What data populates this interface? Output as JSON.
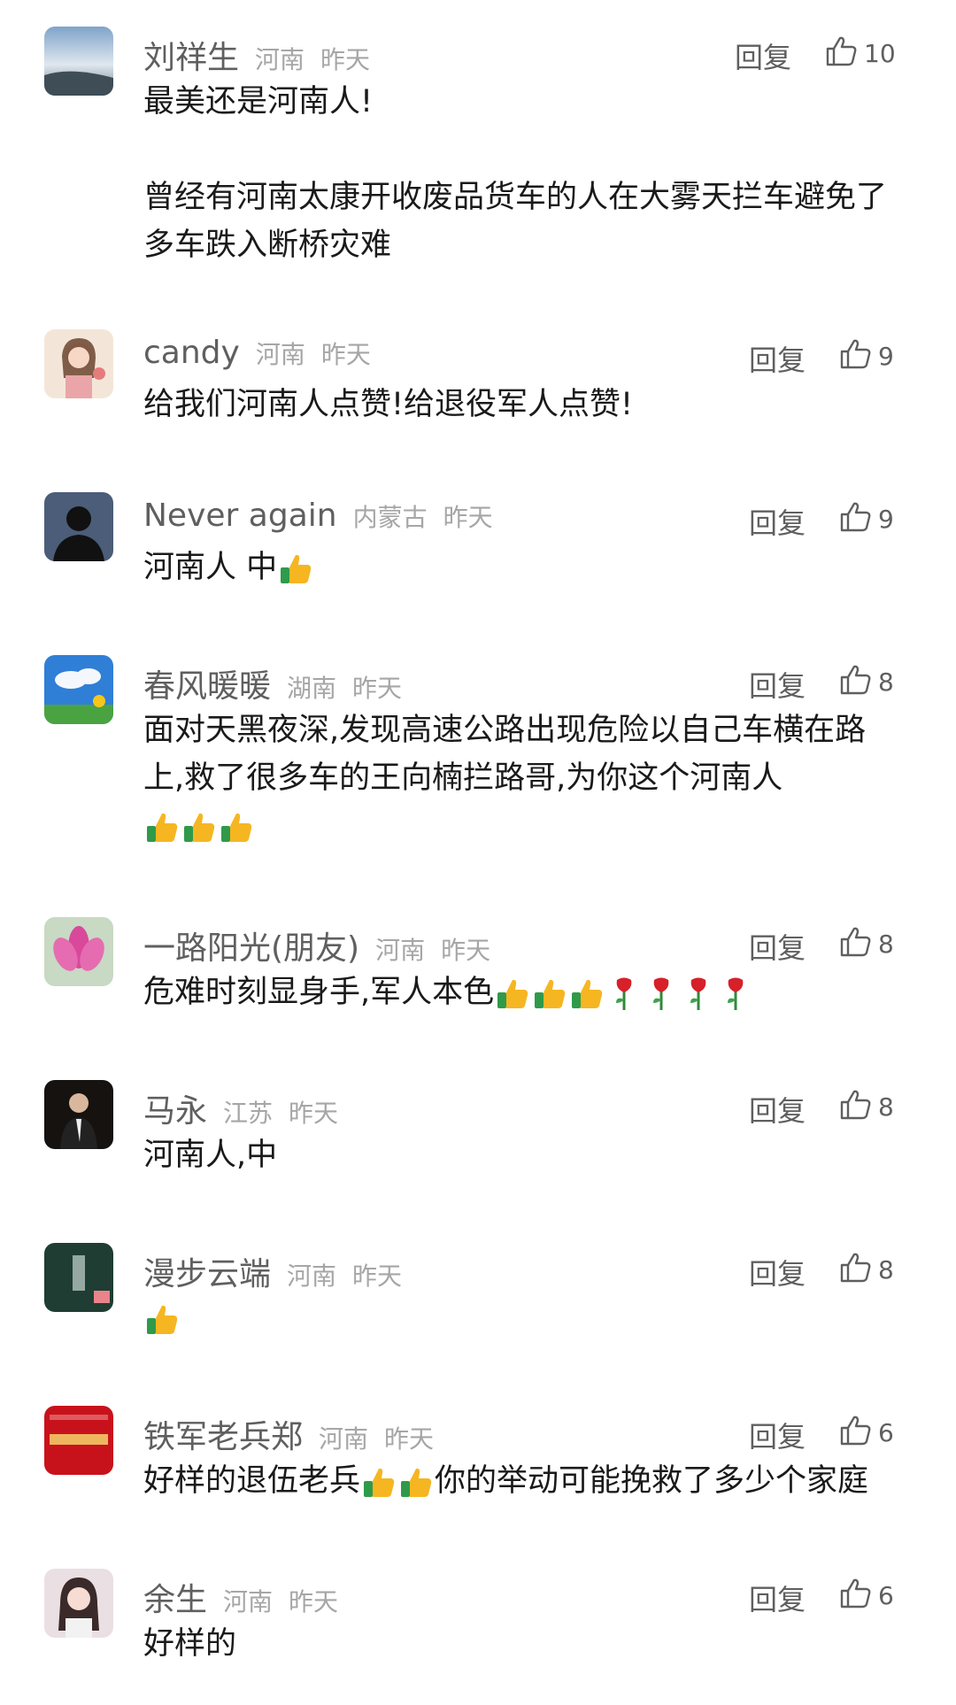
{
  "comments": [
    {
      "name": "刘祥生",
      "location": "河南",
      "time": "昨天",
      "reply": "回复",
      "likes": "10",
      "avatar": "landscape-avatar",
      "text_parts": [
        "最美还是河南人!\n\n曾经有河南太康开收废品货车的人在大雾天拦车避免了多车跌入断桥灾难"
      ]
    },
    {
      "name": "candy",
      "location": "河南",
      "time": "昨天",
      "reply": "回复",
      "likes": "9",
      "avatar": "girl-illustration-avatar",
      "text_parts": [
        "给我们河南人点赞!给退役军人点赞!"
      ]
    },
    {
      "name": "Never again",
      "location": "内蒙古",
      "time": "昨天",
      "reply": "回复",
      "likes": "9",
      "avatar": "silhouette-avatar",
      "text_parts": [
        "河南人 中"
      ],
      "emojis": [
        "thumbs-up"
      ]
    },
    {
      "name": "春风暖暖",
      "location": "湖南",
      "time": "昨天",
      "reply": "回复",
      "likes": "8",
      "avatar": "sky-flower-avatar",
      "text_parts": [
        "面对天黑夜深,发现高速公路出现危险以自己车横在路上,救了很多车的王向楠拦路哥,为你这个河南人"
      ],
      "emojis_newline": [
        "thumbs-up",
        "thumbs-up",
        "thumbs-up"
      ]
    },
    {
      "name": "一路阳光(朋友)",
      "location": "河南",
      "time": "昨天",
      "reply": "回复",
      "likes": "8",
      "avatar": "lotus-avatar",
      "text_parts": [
        "危难时刻显身手,军人本色"
      ],
      "emojis": [
        "thumbs-up",
        "thumbs-up",
        "thumbs-up",
        "rose",
        "rose",
        "rose",
        "rose"
      ]
    },
    {
      "name": "马永",
      "location": "江苏",
      "time": "昨天",
      "reply": "回复",
      "likes": "8",
      "avatar": "man-suit-avatar",
      "text_parts": [
        "河南人,中"
      ]
    },
    {
      "name": "漫步云端",
      "location": "河南",
      "time": "昨天",
      "reply": "回复",
      "likes": "8",
      "avatar": "dark-green-avatar",
      "text_parts": [
        ""
      ],
      "emojis": [
        "thumbs-up"
      ]
    },
    {
      "name": "铁军老兵郑",
      "location": "河南",
      "time": "昨天",
      "reply": "回复",
      "likes": "6",
      "avatar": "red-banner-avatar",
      "text_parts": [
        "好样的退伍老兵",
        "你的举动可能挽救了多少个家庭"
      ],
      "emojis_between": [
        "thumbs-up",
        "thumbs-up"
      ]
    },
    {
      "name": "余生",
      "location": "河南",
      "time": "昨天",
      "reply": "回复",
      "likes": "6",
      "avatar": "woman-portrait-avatar",
      "text_parts": [
        "好样的"
      ]
    }
  ],
  "colors": {
    "name": "#5f5f5f",
    "meta": "#a6a6a6",
    "text": "#1a1a1a"
  }
}
